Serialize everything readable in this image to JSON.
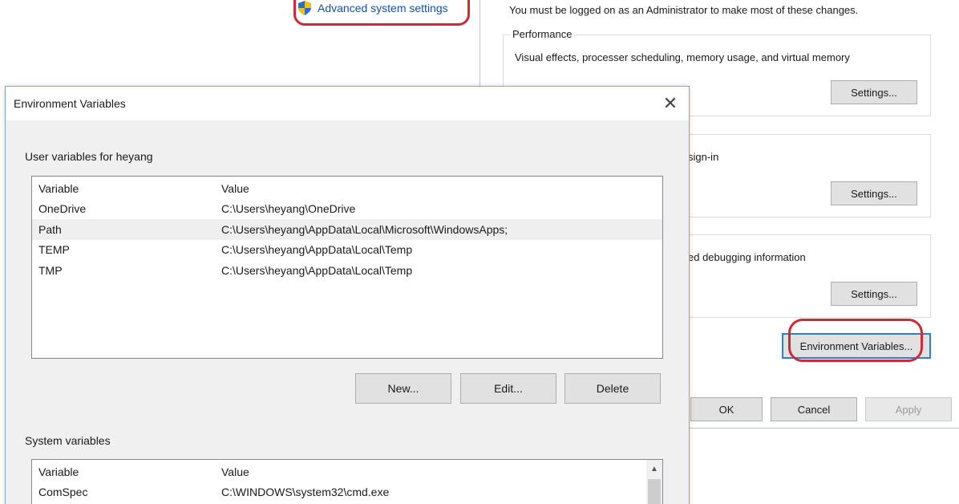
{
  "control_panel": {
    "advanced_link": "Advanced system settings"
  },
  "system_properties": {
    "admin_note": "You must be logged on as an Administrator to make most of these changes.",
    "performance": {
      "title": "Performance",
      "description": "Visual effects, processer scheduling, memory usage, and virtual memory",
      "settings_label": "Settings..."
    },
    "user_profiles": {
      "description_fragment": "sign-in",
      "settings_label": "Settings..."
    },
    "startup_recovery": {
      "description_fragment": "ed debugging information",
      "settings_label": "Settings..."
    },
    "env_vars_button": "Environment Variables...",
    "ok_label": "OK",
    "cancel_label": "Cancel",
    "apply_label": "Apply"
  },
  "env_dialog": {
    "title": "Environment Variables",
    "user_section": {
      "label": "User variables for heyang",
      "columns": [
        "Variable",
        "Value"
      ],
      "rows": [
        {
          "variable": "OneDrive",
          "value": "C:\\Users\\heyang\\OneDrive"
        },
        {
          "variable": "Path",
          "value": "C:\\Users\\heyang\\AppData\\Local\\Microsoft\\WindowsApps;"
        },
        {
          "variable": "TEMP",
          "value": "C:\\Users\\heyang\\AppData\\Local\\Temp"
        },
        {
          "variable": "TMP",
          "value": "C:\\Users\\heyang\\AppData\\Local\\Temp"
        }
      ],
      "selected_row": 1
    },
    "buttons": {
      "new_label": "New...",
      "edit_label": "Edit...",
      "delete_label": "Delete"
    },
    "system_section": {
      "label": "System variables",
      "columns": [
        "Variable",
        "Value"
      ],
      "rows": [
        {
          "variable": "ComSpec",
          "value": "C:\\WINDOWS\\system32\\cmd.exe"
        }
      ]
    }
  },
  "colors": {
    "highlight_circle": "#cf2a36",
    "dialog_border": "#7aa7d6",
    "link_blue": "#1a4fa0"
  }
}
